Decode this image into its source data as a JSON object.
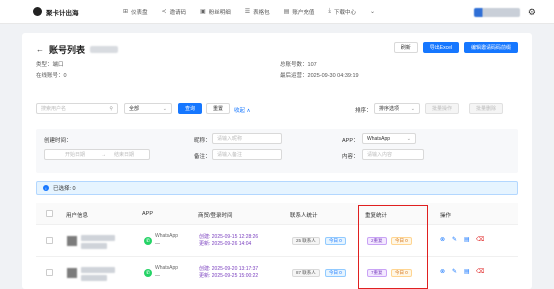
{
  "nav": {
    "logo": "聚卡计出海",
    "items": [
      {
        "icon": "chart-icon",
        "glyph": "⊞",
        "label": "仪表盘"
      },
      {
        "icon": "share-icon",
        "glyph": "≺",
        "label": "邀请码"
      },
      {
        "icon": "account-icon",
        "glyph": "▣",
        "label": "粉丝明细"
      },
      {
        "icon": "list-icon",
        "glyph": "☰",
        "label": "表格包"
      },
      {
        "icon": "doc-icon",
        "glyph": "▤",
        "label": "账户充值"
      },
      {
        "icon": "download-icon",
        "glyph": "⤓",
        "label": "下载中心"
      },
      {
        "icon": "more-icon",
        "glyph": "⌄",
        "label": ""
      }
    ]
  },
  "page": {
    "title": "账号列表",
    "buttons": {
      "refresh": "刷新",
      "export": "导出Excel",
      "batch_edit": "编辑邀请码码前缀"
    },
    "meta": {
      "type_label": "类型：",
      "type_value": "端口",
      "online_label": "在线账号：",
      "online_value": "0",
      "total_label": "总账号数：",
      "total_value": "107",
      "updated_label": "最后运营：",
      "updated_value": "2025-09-30 04:39:19"
    }
  },
  "filters": {
    "search_placeholder": "搜索用户名",
    "status_select": "全部",
    "query_btn": "查询",
    "reset_btn": "重置",
    "collapse_link": "收起 ∧",
    "sort_label": "排序：",
    "sort_select": "排序选项",
    "batch1": "批量操作",
    "batch2": "批量删除"
  },
  "advanced": {
    "created_label": "创建时间：",
    "start_placeholder": "开始日期",
    "end_placeholder": "结束日期",
    "nickname_label": "昵称：",
    "nickname_placeholder": "请输入昵称",
    "remark_label": "备注：",
    "remark_placeholder": "请输入备注",
    "app_label": "APP：",
    "app_select": "WhatsApp",
    "content_label": "内容：",
    "content_placeholder": "请输入内容"
  },
  "selection": {
    "text": "已选择: 0"
  },
  "table": {
    "headers": [
      "用户信息",
      "APP",
      "商贸/登录时间",
      "联系人统计",
      "重复统计",
      "操作"
    ],
    "rows": [
      {
        "app": "WhatsApp",
        "app_sub": "—",
        "created": "创建: 2025-09-15 12:28:26",
        "updated": "更新: 2025-09-26 14:04",
        "contact_count": "25 联系人",
        "contact_today": "今日 0",
        "dup_count": "2重复",
        "dup_today": "今日 0"
      },
      {
        "app": "WhatsApp",
        "app_sub": "—",
        "created": "创建: 2025-09-20 13:17:37",
        "updated": "更新: 2025-09-25 15:00:22",
        "contact_count": "87 联系人",
        "contact_today": "今日 0",
        "dup_count": "7重复",
        "dup_today": "今日 0"
      }
    ]
  },
  "colors": {
    "primary": "#1677ff",
    "highlight": "#e02020",
    "whatsapp": "#25d366"
  }
}
